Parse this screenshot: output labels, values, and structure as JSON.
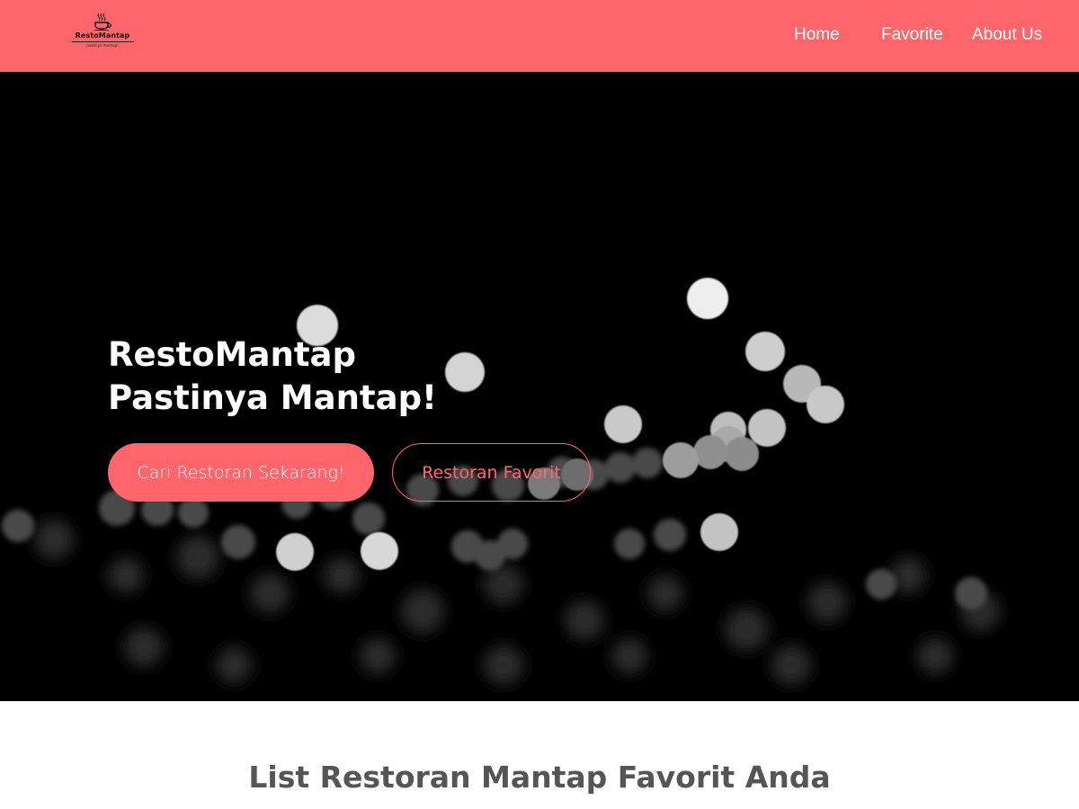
{
  "header": {
    "logo": {
      "name": "RestoMantap",
      "tagline": "pastinya mantap!"
    },
    "nav": [
      {
        "label": "Home"
      },
      {
        "label": "Favorite"
      },
      {
        "label": "About Us"
      }
    ],
    "colors": {
      "accent": "#ff666c"
    }
  },
  "hero": {
    "title_line1": "RestoMantap",
    "title_line2": "Pastinya Mantap!",
    "primary_button": "Cari Restoran Sekarang!",
    "secondary_button": "Restoran Favorit"
  },
  "main": {
    "section_title": "List Restoran Mantap Favorit Anda"
  }
}
